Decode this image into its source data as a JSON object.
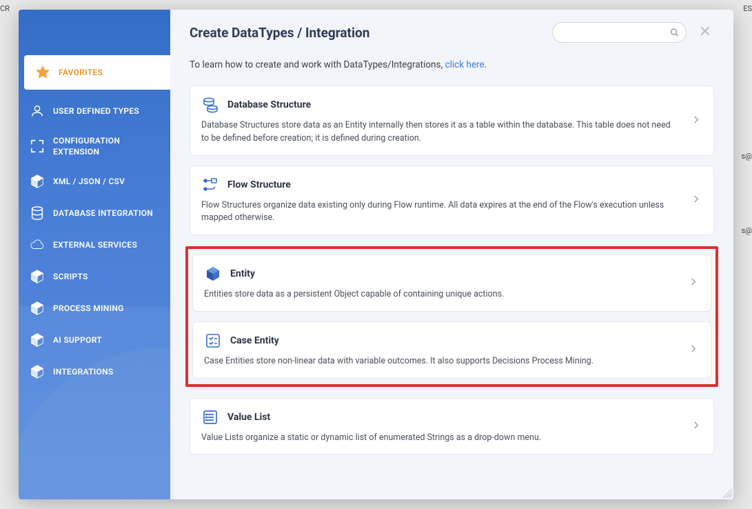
{
  "bg": {
    "left": "CR",
    "right": "ES",
    "s_right": "s@"
  },
  "header": {
    "title": "Create DataTypes / Integration",
    "search_placeholder": ""
  },
  "intro": {
    "prefix": "To learn how to create and work with DataTypes/Integrations, ",
    "link_label": "click here",
    "suffix": "."
  },
  "sidebar": {
    "items": [
      {
        "label": "FAVORITES",
        "icon": "star-icon",
        "active": true
      },
      {
        "label": "USER DEFINED TYPES",
        "icon": "user-icon"
      },
      {
        "label": "CONFIGURATION EXTENSION",
        "icon": "expand-icon"
      },
      {
        "label": "XML / JSON / CSV",
        "icon": "cube-icon"
      },
      {
        "label": "DATABASE INTEGRATION",
        "icon": "database-icon"
      },
      {
        "label": "EXTERNAL SERVICES",
        "icon": "cloud-icon"
      },
      {
        "label": "SCRIPTS",
        "icon": "cube-icon"
      },
      {
        "label": "PROCESS MINING",
        "icon": "cube-icon"
      },
      {
        "label": "AI SUPPORT",
        "icon": "cube-icon"
      },
      {
        "label": "INTEGRATIONS",
        "icon": "cube-icon"
      }
    ]
  },
  "cards": [
    {
      "title": "Database Structure",
      "icon": "database-layers-icon",
      "desc": "Database Structures store data as an Entity internally then stores it as a table within the database. This table does not need to be defined before creation; it is defined during creation."
    },
    {
      "title": "Flow Structure",
      "icon": "flow-icon",
      "desc": "Flow Structures organize data existing only during Flow runtime. All data expires at the end of the Flow's execution unless mapped otherwise."
    },
    {
      "title": "Entity",
      "icon": "cube3d-icon",
      "desc": "Entities store data as a persistent Object capable of containing unique actions."
    },
    {
      "title": "Case Entity",
      "icon": "checklist-icon",
      "desc": "Case Entities store non-linear data with variable outcomes. It also supports Decisions Process Mining."
    },
    {
      "title": "Value List",
      "icon": "list-icon",
      "desc": "Value Lists organize a static or dynamic list of enumerated Strings as a drop-down menu."
    }
  ]
}
